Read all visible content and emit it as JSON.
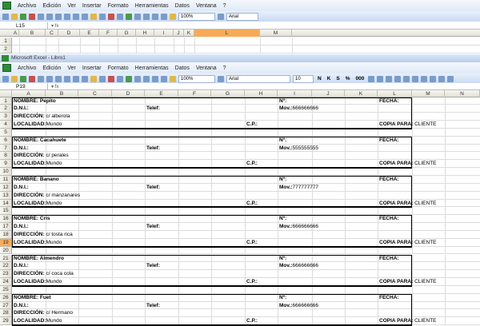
{
  "window_title": "Microsoft Excel - Libro1",
  "menu": [
    "Archivo",
    "Edición",
    "Ver",
    "Insertar",
    "Formato",
    "Herramientas",
    "Datos",
    "Ventana",
    "?"
  ],
  "toolbar": {
    "zoom": "100%",
    "font": "Arial",
    "size": "10",
    "buttons": [
      "N",
      "K",
      "S",
      "%",
      "000"
    ]
  },
  "top_sheet": {
    "name_box": "L15",
    "columns": [
      "A",
      "B",
      "C",
      "D",
      "E",
      "F",
      "G",
      "H",
      "I",
      "J",
      "K",
      "L",
      "M"
    ],
    "rows": [
      "1",
      "2"
    ],
    "selected_column": "L"
  },
  "main_sheet": {
    "name_box": "P19",
    "columns": [
      "A",
      "B",
      "C",
      "D",
      "E",
      "F",
      "G",
      "H",
      "I",
      "J",
      "K",
      "L",
      "M",
      "N"
    ],
    "selected_row": "19",
    "labels": {
      "nombre": "NOMBRE:",
      "num": "Nº:",
      "fecha": "FECHA:",
      "dni": "D.N.I.:",
      "telef": "Telef:",
      "mov": "Mov.:",
      "direccion": "DIRECCIÓN:",
      "localidad": "LOCALIDAD:",
      "cp": "C.P.:",
      "copia": "COPIA PARA:"
    },
    "records": [
      {
        "nombre": "Pepito",
        "mov": "666666666",
        "direccion": "c/ alberola",
        "localidad": "Mundo",
        "copia": "CLIENTE"
      },
      {
        "nombre": "Cacahuete",
        "mov": "555555555",
        "direccion": "c/ perales",
        "localidad": "Mundo",
        "copia": "CLIENTE"
      },
      {
        "nombre": "Banano",
        "mov": "777777777",
        "direccion": "c/ manzanares",
        "localidad": "Mundo",
        "copia": "CLIENTE"
      },
      {
        "nombre": "Cris",
        "mov": "666666666",
        "direccion": "c/ tosta rica",
        "localidad": "Mundo",
        "copia": "CLIENTE"
      },
      {
        "nombre": "Almendro",
        "mov": "666666666",
        "direccion": "c/ coca cola",
        "localidad": "Mundo",
        "copia": "CLIENTE"
      },
      {
        "nombre": "Fuet",
        "mov": "666666666",
        "direccion": "c/ Hermano",
        "localidad": "Mundo",
        "copia": "CLIENTE"
      }
    ]
  }
}
